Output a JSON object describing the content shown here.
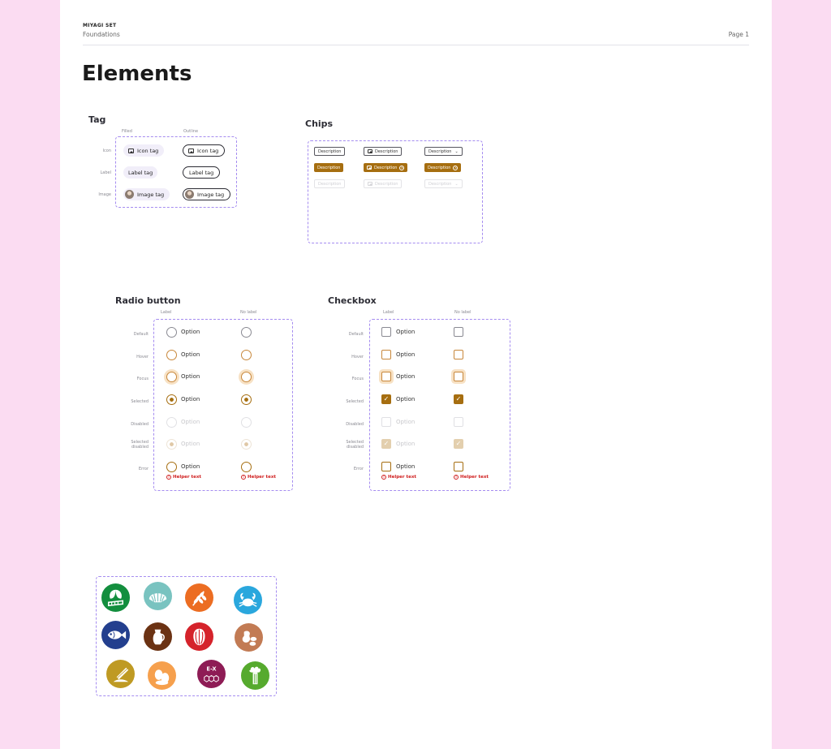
{
  "header": {
    "brand": "MIYAGI SET",
    "section": "Foundations",
    "page": "Page 1"
  },
  "title": "Elements",
  "tag": {
    "heading": "Tag",
    "columns": [
      "Filled",
      "Outline"
    ],
    "rows": [
      "Icon",
      "Label",
      "Image"
    ],
    "icon_tag": "Icon tag",
    "label_tag": "Label tag",
    "image_tag": "Image tag"
  },
  "chips": {
    "heading": "Chips",
    "label": "Description"
  },
  "radio": {
    "heading": "Radio button",
    "columns": [
      "Label",
      "No label"
    ],
    "states": [
      "Default",
      "Hover",
      "Focus",
      "Selected",
      "Disabled",
      "Selected disabled",
      "Error"
    ],
    "option": "Option",
    "helper": "Helper text"
  },
  "checkbox": {
    "heading": "Checkbox",
    "columns": [
      "Label",
      "No label"
    ],
    "states": [
      "Default",
      "Hover",
      "Focus",
      "Selected",
      "Disabled",
      "Selected disabled",
      "Error"
    ],
    "option": "Option",
    "helper": "Helper text"
  },
  "allergens": {
    "icons": [
      "celery-leaf-icon",
      "shellfish-icon",
      "gluten-wheat-icon",
      "crustacean-crab-icon",
      "fish-icon",
      "milk-jug-icon",
      "nuts-icon",
      "peanut-icon",
      "mustard-icon",
      "eggs-icon",
      "additives-ex-icon",
      "celery-icon"
    ],
    "ex_label": "E-X"
  },
  "colors": {
    "accent": "#a66e10",
    "hover": "#c8873a",
    "focus_ring": "#f7e1c4",
    "error": "#d02020",
    "dashed_border": "#a58cf0",
    "background": "#fbdcf2"
  }
}
